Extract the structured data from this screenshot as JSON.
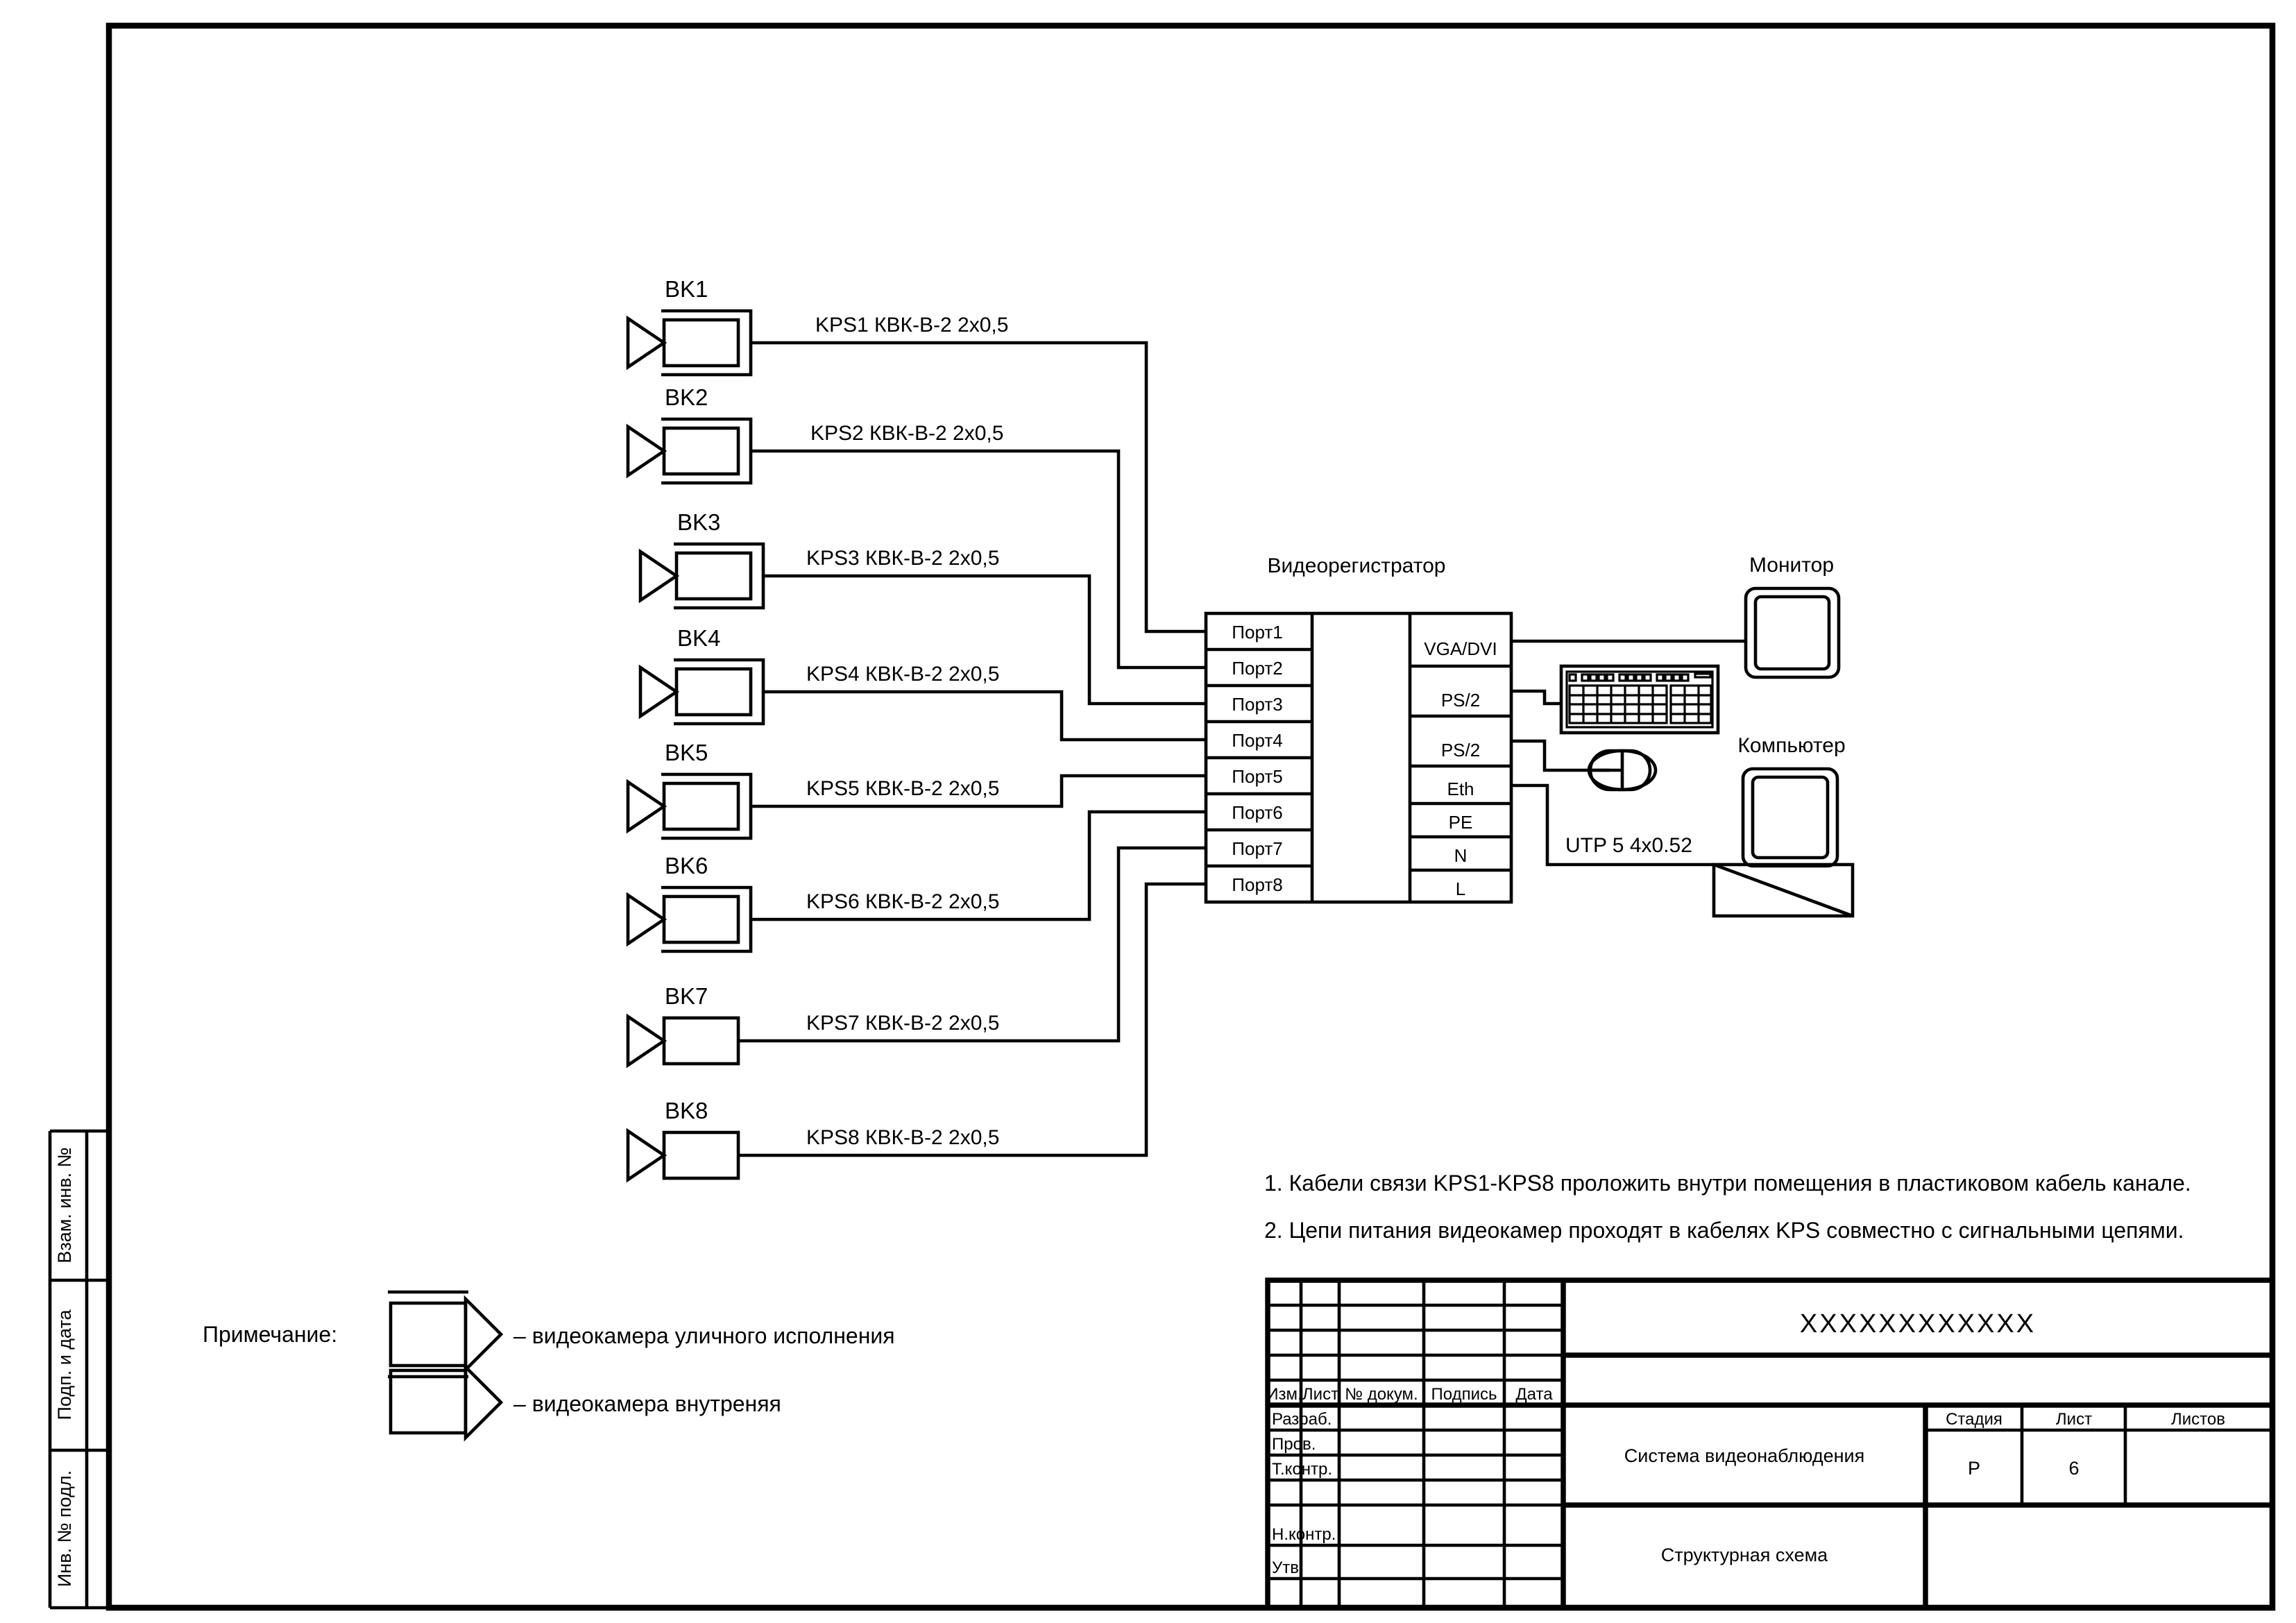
{
  "document": {
    "kind": "technical-drawing",
    "sheet_format": "A3",
    "stage_value": "Р",
    "sheet_number": "6",
    "sheets_total": ""
  },
  "diagram": {
    "dvr": {
      "caption": "Видеорегистратор",
      "input_ports": [
        "Порт1",
        "Порт2",
        "Порт3",
        "Порт4",
        "Порт5",
        "Порт6",
        "Порт7",
        "Порт8"
      ],
      "output_ports": [
        "VGA/DVI",
        "PS/2",
        "PS/2",
        "Eth",
        "PE",
        "N",
        "L"
      ]
    },
    "cameras": [
      {
        "tag": "BK1",
        "cable": "KPS1  КВК-В-2 2х0,5",
        "type": "outdoor",
        "port": "Порт1"
      },
      {
        "tag": "BK2",
        "cable": "KPS2  КВК-В-2 2х0,5",
        "type": "outdoor",
        "port": "Порт2"
      },
      {
        "tag": "BK3",
        "cable": "KPS3  КВК-В-2 2х0,5",
        "type": "outdoor",
        "port": "Порт3"
      },
      {
        "tag": "BK4",
        "cable": "KPS4  КВК-В-2 2х0,5",
        "type": "outdoor",
        "port": "Порт4"
      },
      {
        "tag": "BK5",
        "cable": "KPS5  КВК-В-2 2х0,5",
        "type": "outdoor",
        "port": "Порт5"
      },
      {
        "tag": "BK6",
        "cable": "KPS6  КВК-В-2 2х0,5",
        "type": "outdoor",
        "port": "Порт6"
      },
      {
        "tag": "BK7",
        "cable": "KPS7  КВК-В-2 2х0,5",
        "type": "indoor",
        "port": "Порт7"
      },
      {
        "tag": "BK8",
        "cable": "KPS8  КВК-В-2 2х0,5",
        "type": "indoor",
        "port": "Порт8"
      }
    ],
    "peripherals": [
      {
        "name": "monitor",
        "label": "Монитор",
        "from_port": "VGA/DVI"
      },
      {
        "name": "keyboard",
        "label": "",
        "from_port": "PS/2"
      },
      {
        "name": "mouse",
        "label": "",
        "from_port": "PS/2"
      },
      {
        "name": "computer",
        "label": "Компьютер",
        "from_port": "Eth"
      }
    ],
    "eth_cable_label": "UTP 5 4х0.52"
  },
  "notes": {
    "items": [
      "1. Кабели связи KPS1-KPS8 проложить внутри помещения в пластиковом кабель канале.",
      "2. Цепи питания видеокамер проходят в кабелях KPS совместно с сигнальными цепями."
    ]
  },
  "legend": {
    "title": "Примечание:",
    "entries": [
      {
        "symbol": "outdoor-camera",
        "text": "– видеокамера уличного исполнения"
      },
      {
        "symbol": "indoor-camera",
        "text": "– видеокамера внутреняя"
      }
    ]
  },
  "title_block": {
    "org_name": "XXXXXXXXXXXX",
    "object_name": "Система видеонаблюдения",
    "drawing_name": "Структурная схема",
    "revision_headers": [
      "Изм.",
      "Лист",
      "№ докум.",
      "Подпись",
      "Дата"
    ],
    "role_rows": [
      "Разраб.",
      "Пров.",
      "Т.контр.",
      "",
      "Н.контр.",
      "Утв."
    ],
    "stage_headers": [
      "Стадия",
      "Лист",
      "Листов"
    ],
    "stage_values": [
      "Р",
      "6",
      ""
    ]
  },
  "side_margin": {
    "labels": [
      "Взам. инв. №",
      "Подп. и дата",
      "Инв. № подл."
    ]
  }
}
